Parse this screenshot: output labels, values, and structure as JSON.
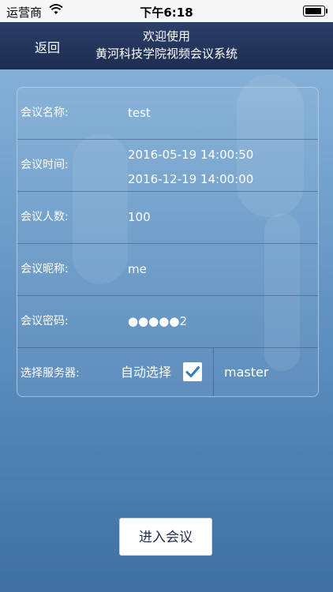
{
  "status_bar": {
    "carrier": "运营商",
    "time": "下午6:18",
    "wifi_icon": "wifi-icon",
    "battery_icon": "battery-icon"
  },
  "nav": {
    "back_label": "返回",
    "title_line1": "欢迎使用",
    "title_line2": "黄河科技学院视频会议系统"
  },
  "form": {
    "meeting_name": {
      "label": "会议名称:",
      "value": "test"
    },
    "meeting_time": {
      "label": "会议时间:",
      "start": "2016-05-19 14:00:50",
      "end": "2016-12-19 14:00:00"
    },
    "meeting_count": {
      "label": "会议人数:",
      "value": "100"
    },
    "nickname": {
      "label": "会议昵称:",
      "value": "me"
    },
    "password": {
      "label": "会议密码:",
      "value": "●●●●●2"
    },
    "server": {
      "label": "选择服务器:",
      "auto_label": "自动选择",
      "auto_checked": true,
      "name": "master"
    }
  },
  "enter_button_label": "进入会议",
  "colors": {
    "nav_bg": "#1d2d51",
    "check_color": "#2e7fc0"
  }
}
